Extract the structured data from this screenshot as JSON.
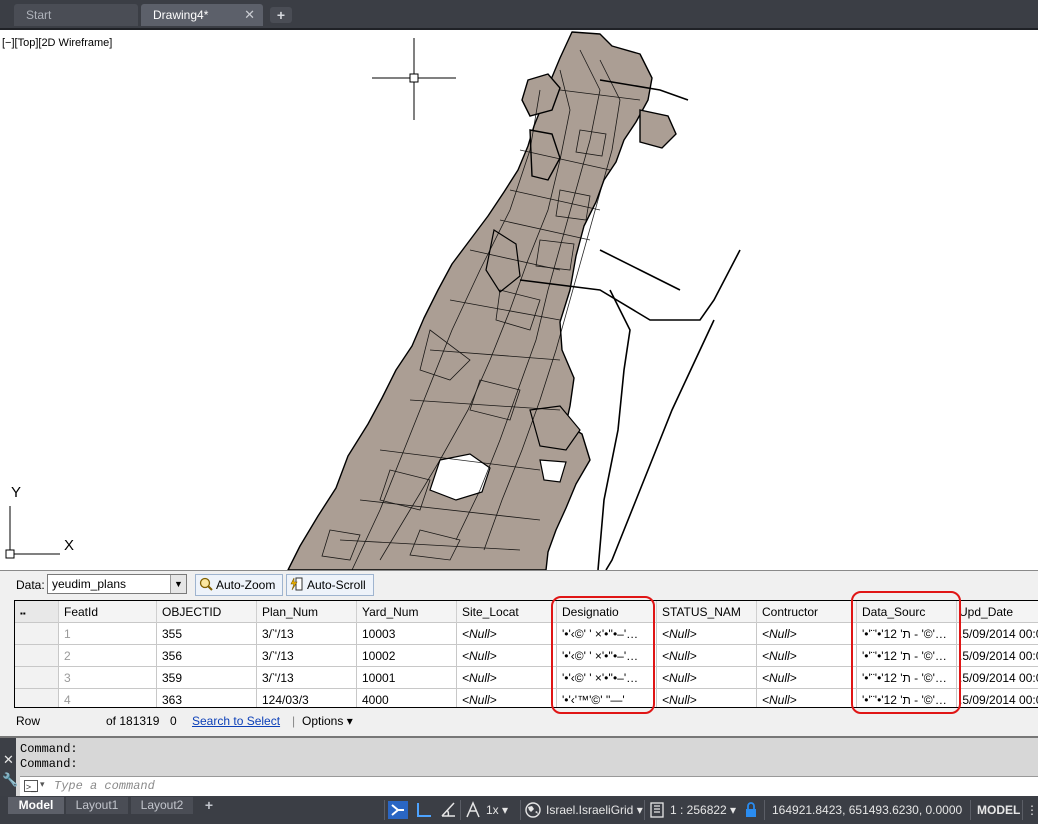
{
  "tabs": {
    "start": "Start",
    "drawing": "Drawing4*",
    "close_glyph": "✕",
    "add_glyph": "+"
  },
  "viewport": {
    "label": "[−][Top][2D Wireframe]",
    "ucs_x": "X",
    "ucs_y": "Y",
    "map_fill": "#ab9e94"
  },
  "data_panel": {
    "data_label": "Data:",
    "dataset": "yeudim_plans",
    "auto_zoom": "Auto-Zoom",
    "auto_scroll": "Auto-Scroll",
    "columns": [
      "FeatId",
      "OBJECTID",
      "Plan_Num",
      "Yard_Num",
      "Site_Locat",
      "Designatio",
      "STATUS_NAM",
      "Contructor",
      "Data_Sourc",
      "Upd_Date"
    ],
    "rows": [
      [
        "1",
        "355",
        "3/‵'/13",
        "10003",
        "<Null>",
        "'•'‹©' ' ×'•''•–'…",
        "<Null>",
        "<Null>",
        "'•'¨'•'ת' 12 - '©'…",
        ".5/09/2014 00:0"
      ],
      [
        "2",
        "356",
        "3/‵'/13",
        "10002",
        "<Null>",
        "'•'‹©' ' ×'•''•–'…",
        "<Null>",
        "<Null>",
        "'•'¨'•'ת' 12 - '©'…",
        ".5/09/2014 00:0"
      ],
      [
        "3",
        "359",
        "3/‵'/13",
        "10001",
        "<Null>",
        "'•'‹©' ' ×'•''•–'…",
        "<Null>",
        "<Null>",
        "'•'¨'•'ת' 12 - '©'…",
        ".5/09/2014 00:0"
      ],
      [
        "4",
        "363",
        "124/03/3",
        "4000",
        "<Null>",
        "'•'‹'™'©' ''—'",
        "<Null>",
        "<Null>",
        "'•'¨'•'ת' 12 - '©'…",
        ".5/09/2014 00:0"
      ]
    ],
    "footer": {
      "row_label": "Row",
      "of_count": "of 181319",
      "selected": "0",
      "search_to_select": "Search to Select",
      "separator": "|",
      "options": "Options  ▾"
    },
    "highlight_color": "#e01515"
  },
  "command": {
    "history": [
      "Command:",
      "Command:"
    ],
    "placeholder": "Type a command",
    "close_glyph": "✕",
    "wrench_glyph": "🔧"
  },
  "status": {
    "layout_tabs": [
      "Model",
      "Layout1",
      "Layout2"
    ],
    "add_glyph": "+",
    "zoom": "1x ▾",
    "coord_system": "Israel.IsraeliGrid ▾",
    "scale": "1 : 256822 ▾",
    "coordinates": "164921.8423, 651493.6230, 0.0000",
    "model": "MODEL"
  }
}
